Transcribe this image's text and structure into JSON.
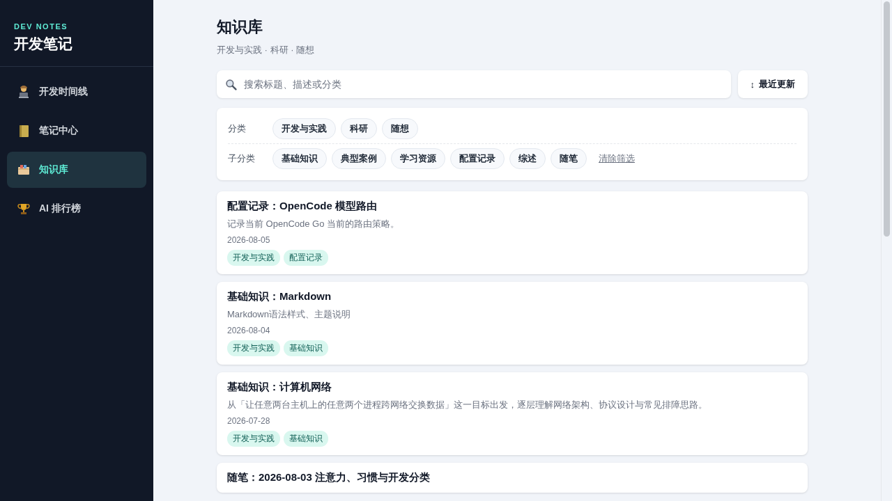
{
  "sidebar": {
    "eyebrow": "DEV NOTES",
    "title": "开发笔记",
    "items": [
      {
        "label": "开发时间线",
        "selected": false
      },
      {
        "label": "笔记中心",
        "selected": false
      },
      {
        "label": "知识库",
        "selected": true
      },
      {
        "label": "AI 排行榜",
        "selected": false
      }
    ]
  },
  "header": {
    "title": "知识库",
    "subtitle": "开发与实践 · 科研 · 随想"
  },
  "search": {
    "placeholder": "搜索标题、描述或分类"
  },
  "sort_button": {
    "icon": "↕",
    "label": "最近更新"
  },
  "filters": {
    "category_label": "分类",
    "categories": [
      {
        "label": "开发与实践",
        "selected": false
      },
      {
        "label": "科研",
        "selected": false
      },
      {
        "label": "随想",
        "selected": false
      }
    ],
    "subcategory_label": "子分类",
    "subcategories": [
      {
        "label": "基础知识",
        "selected": false
      },
      {
        "label": "典型案例",
        "selected": false
      },
      {
        "label": "学习资源",
        "selected": false
      },
      {
        "label": "配置记录",
        "selected": false
      },
      {
        "label": "综述",
        "selected": false
      },
      {
        "label": "随笔",
        "selected": false
      }
    ],
    "clear": "清除筛选"
  },
  "articles": [
    {
      "title": "配置记录：OpenCode 模型路由",
      "description": "记录当前 OpenCode Go 当前的路由策略。",
      "date": "2026-08-05",
      "tags": [
        "开发与实践",
        "配置记录"
      ]
    },
    {
      "title": "基础知识：Markdown",
      "description": "Markdown语法样式、主题说明",
      "date": "2026-08-04",
      "tags": [
        "开发与实践",
        "基础知识"
      ]
    },
    {
      "title": "基础知识：计算机网络",
      "description": "从「让任意两台主机上的任意两个进程跨网络交换数据」这一目标出发，逐层理解网络架构、协议设计与常见排障思路。",
      "date": "2026-07-28",
      "tags": [
        "开发与实践",
        "基础知识"
      ]
    },
    {
      "title": "随笔：2026-08-03 注意力、习惯与开发分类"
    }
  ]
}
